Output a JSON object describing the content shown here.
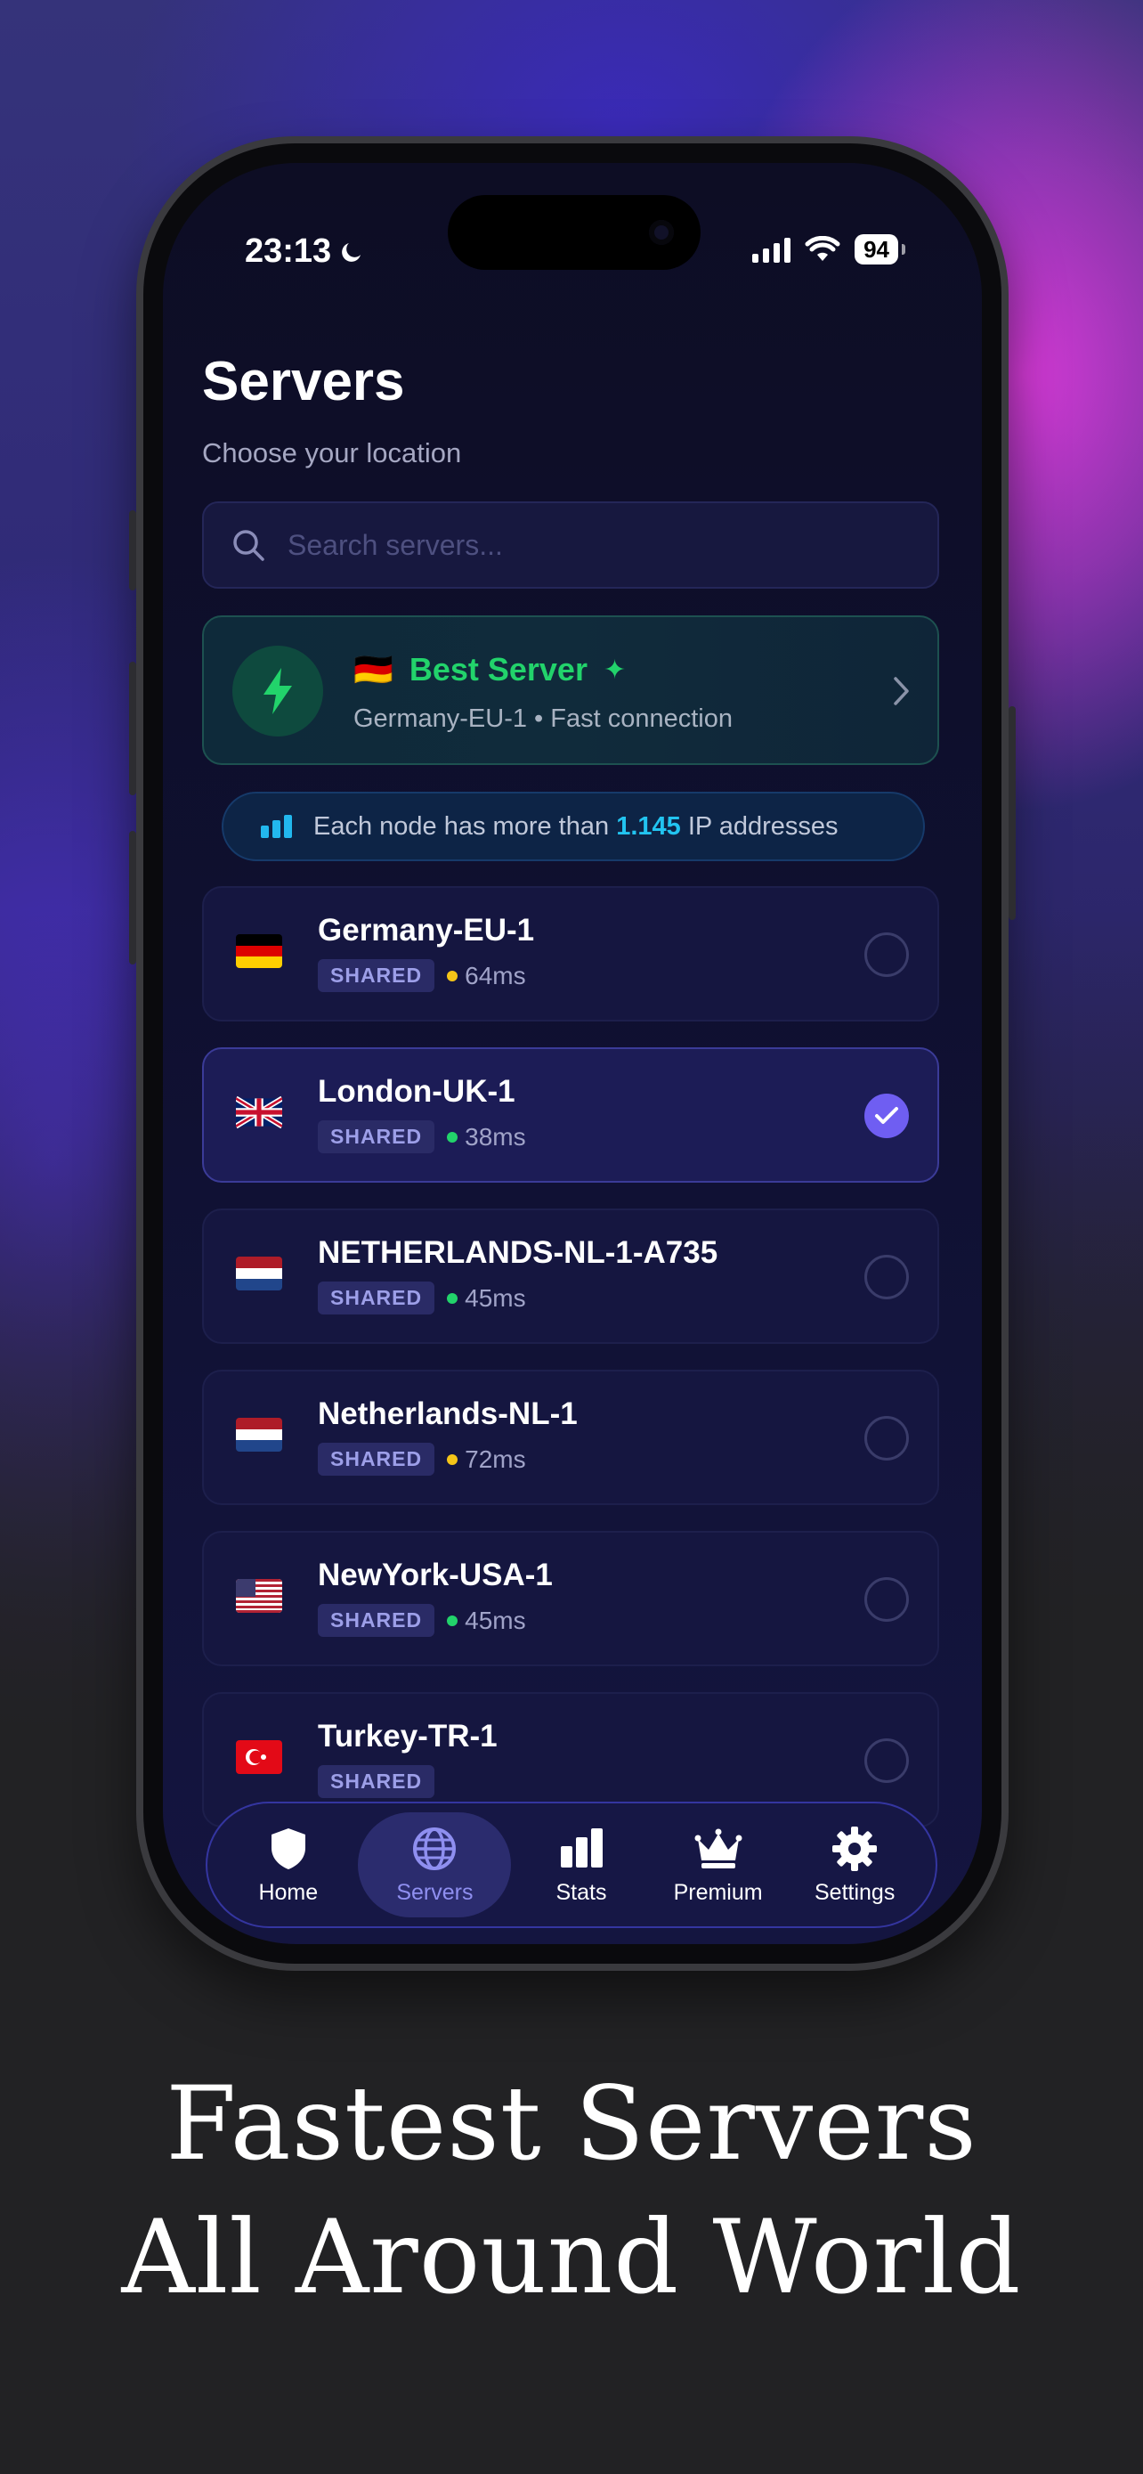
{
  "status_bar": {
    "time": "23:13",
    "battery": "94"
  },
  "header": {
    "title": "Servers",
    "subtitle": "Choose your location"
  },
  "search": {
    "placeholder": "Search servers..."
  },
  "best_server": {
    "flag": "🇩🇪",
    "label": "Best Server",
    "subtitle": "Germany-EU-1 • Fast connection"
  },
  "info_banner": {
    "prefix": "Each node has more than",
    "count": "1.145",
    "suffix": "IP addresses"
  },
  "servers": [
    {
      "name": "Germany-EU-1",
      "flag": "de",
      "badge": "SHARED",
      "ping": "64ms",
      "ping_color": "#f5c518",
      "selected": false
    },
    {
      "name": "London-UK-1",
      "flag": "gb",
      "badge": "SHARED",
      "ping": "38ms",
      "ping_color": "#22d36b",
      "selected": true
    },
    {
      "name": "NETHERLANDS-NL-1-A735",
      "flag": "nl",
      "badge": "SHARED",
      "ping": "45ms",
      "ping_color": "#22d36b",
      "selected": false
    },
    {
      "name": "Netherlands-NL-1",
      "flag": "nl",
      "badge": "SHARED",
      "ping": "72ms",
      "ping_color": "#f5c518",
      "selected": false
    },
    {
      "name": "NewYork-USA-1",
      "flag": "us",
      "badge": "SHARED",
      "ping": "45ms",
      "ping_color": "#22d36b",
      "selected": false
    },
    {
      "name": "Turkey-TR-1",
      "flag": "tr",
      "badge": "SHARED",
      "ping": "",
      "ping_color": "#22d36b",
      "selected": false
    }
  ],
  "tabs": [
    {
      "label": "Home",
      "icon": "shield-icon",
      "active": false
    },
    {
      "label": "Servers",
      "icon": "globe-icon",
      "active": true
    },
    {
      "label": "Stats",
      "icon": "bar-chart-icon",
      "active": false
    },
    {
      "label": "Premium",
      "icon": "crown-icon",
      "active": false
    },
    {
      "label": "Settings",
      "icon": "gear-icon",
      "active": false
    }
  ],
  "caption": {
    "line1": "Fastest Servers",
    "line2": "All Around World"
  },
  "colors": {
    "accent": "#6f5ef2",
    "success": "#22d36b",
    "info": "#22c4f0",
    "warning": "#f5c518"
  }
}
